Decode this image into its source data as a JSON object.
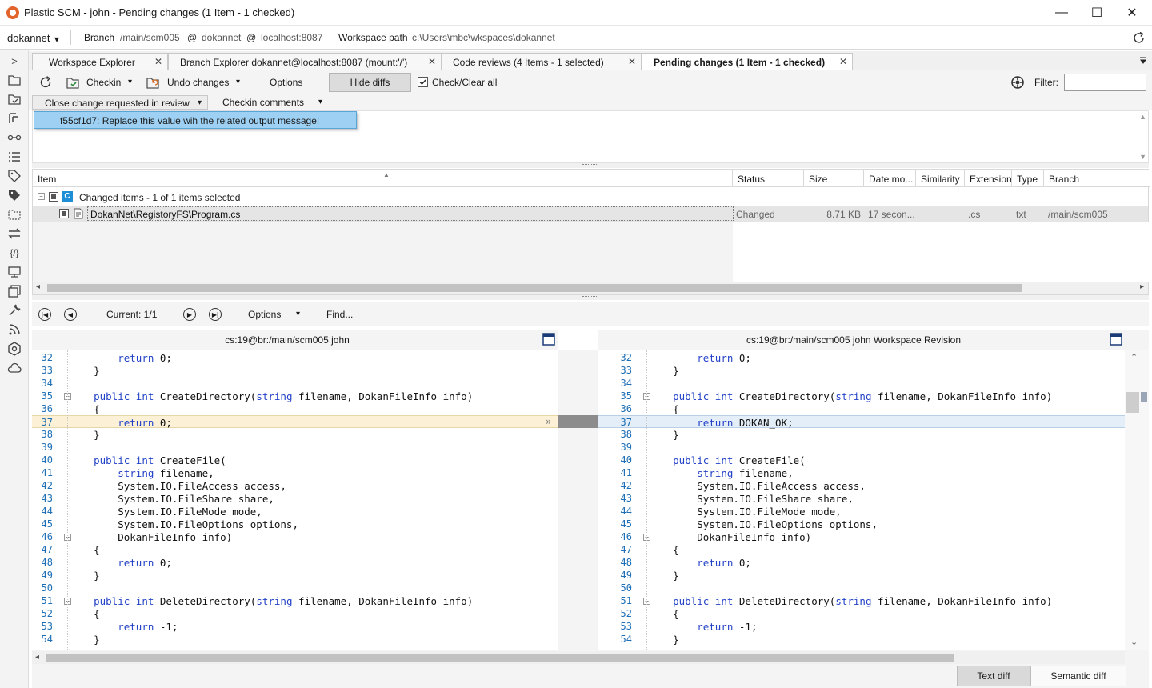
{
  "window": {
    "title": "Plastic SCM - john - Pending changes (1 Item - 1 checked)",
    "minimize": "—",
    "maximize": "☐",
    "close": "✕"
  },
  "branchbar": {
    "workspace": "dokannet",
    "branch_label": "Branch",
    "branch": "/main/scm005",
    "at1": "@",
    "repo": "dokannet",
    "at2": "@",
    "server": "localhost:8087",
    "wkpath_label": "Workspace path",
    "wkpath": "c:\\Users\\mbc\\wkspaces\\dokannet"
  },
  "sidebar": {
    "expand": ">",
    "icons": [
      "folder-icon",
      "folder-check-icon",
      "branch-icon",
      "changeset-icon",
      "list-icon",
      "label-icon",
      "labels-icon",
      "dashed-folder-icon",
      "sync-icon",
      "code-icon",
      "monitor-icon",
      "windows-icon",
      "wrench-icon",
      "rss-icon",
      "plastic-icon",
      "cloud-icon"
    ]
  },
  "tabs": [
    {
      "label": "Workspace Explorer"
    },
    {
      "label": "Branch Explorer dokannet@localhost:8087 (mount:'/')"
    },
    {
      "label": "Code reviews (4 Items - 1 selected)"
    },
    {
      "label": "Pending changes (1 Item - 1 checked)"
    }
  ],
  "toolbar": {
    "checkin": "Checkin",
    "undo": "Undo changes",
    "options": "Options",
    "hide_diffs": "Hide diffs",
    "check_clear": "Check/Clear all",
    "filter_label": "Filter:",
    "filter_value": ""
  },
  "review": {
    "close_change": "Close change requested in review",
    "checkin_comments": "Checkin comments",
    "popup_item": "f55cf1d7: Replace this value wih the related output message!"
  },
  "items": {
    "columns": [
      "Item",
      "Status",
      "Size",
      "Date mo...",
      "Similarity",
      "Extension",
      "Type",
      "Branch"
    ],
    "group_badge": "C",
    "group_label": "Changed items - 1 of 1 items selected",
    "rows": [
      {
        "item": "DokanNet\\RegistoryFS\\Program.cs",
        "status": "Changed",
        "size": "8.71 KB",
        "date": "17 secon...",
        "similarity": "",
        "extension": ".cs",
        "type": "txt",
        "branch": "/main/scm005"
      }
    ]
  },
  "difftoolbar": {
    "current": "Current: 1/1",
    "options": "Options",
    "find": "Find..."
  },
  "diff": {
    "left_title": "cs:19@br:/main/scm005 john",
    "right_title": "cs:19@br:/main/scm005 john Workspace Revision",
    "lines": [
      {
        "n": "32",
        "l": "        return 0;",
        "r": "        return 0;"
      },
      {
        "n": "33",
        "l": "    }",
        "r": "    }"
      },
      {
        "n": "34",
        "l": "",
        "r": ""
      },
      {
        "n": "35",
        "l": "    public int CreateDirectory(string filename, DokanFileInfo info)",
        "r": "    public int CreateDirectory(string filename, DokanFileInfo info)"
      },
      {
        "n": "36",
        "l": "    {",
        "r": "    {"
      },
      {
        "n": "37",
        "l": "        return 0;",
        "r": "        return DOKAN_OK;"
      },
      {
        "n": "38",
        "l": "    }",
        "r": "    }"
      },
      {
        "n": "39",
        "l": "",
        "r": ""
      },
      {
        "n": "40",
        "l": "    public int CreateFile(",
        "r": "    public int CreateFile("
      },
      {
        "n": "41",
        "l": "        string filename,",
        "r": "        string filename,"
      },
      {
        "n": "42",
        "l": "        System.IO.FileAccess access,",
        "r": "        System.IO.FileAccess access,"
      },
      {
        "n": "43",
        "l": "        System.IO.FileShare share,",
        "r": "        System.IO.FileShare share,"
      },
      {
        "n": "44",
        "l": "        System.IO.FileMode mode,",
        "r": "        System.IO.FileMode mode,"
      },
      {
        "n": "45",
        "l": "        System.IO.FileOptions options,",
        "r": "        System.IO.FileOptions options,"
      },
      {
        "n": "46",
        "l": "        DokanFileInfo info)",
        "r": "        DokanFileInfo info)"
      },
      {
        "n": "47",
        "l": "    {",
        "r": "    {"
      },
      {
        "n": "48",
        "l": "        return 0;",
        "r": "        return 0;"
      },
      {
        "n": "49",
        "l": "    }",
        "r": "    }"
      },
      {
        "n": "50",
        "l": "",
        "r": ""
      },
      {
        "n": "51",
        "l": "    public int DeleteDirectory(string filename, DokanFileInfo info)",
        "r": "    public int DeleteDirectory(string filename, DokanFileInfo info)"
      },
      {
        "n": "52",
        "l": "    {",
        "r": "    {"
      },
      {
        "n": "53",
        "l": "        return -1;",
        "r": "        return -1;"
      },
      {
        "n": "54",
        "l": "    }",
        "r": "    }"
      }
    ],
    "changed_line": "37",
    "fold_lines": [
      "35",
      "46",
      "51"
    ]
  },
  "bottom": {
    "text_diff": "Text diff",
    "semantic_diff": "Semantic diff"
  },
  "colors": {
    "accent": "#e2632c",
    "changed_left": "#fcf1d6",
    "changed_right": "#e4eef8",
    "popup": "#9dd0f2",
    "keyword": "#2442c8",
    "linenum": "#1e6fb5"
  }
}
